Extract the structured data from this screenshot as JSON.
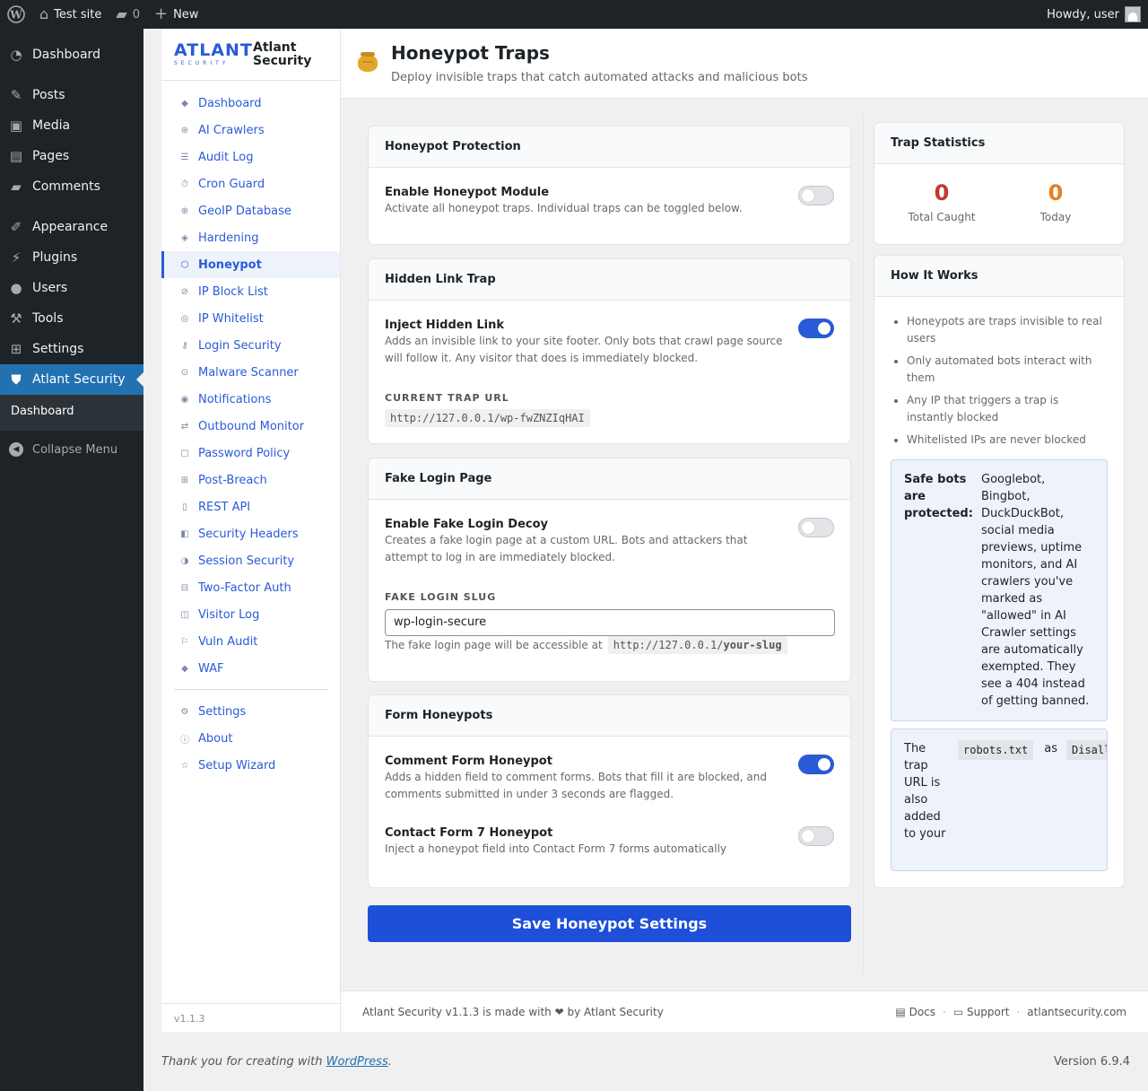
{
  "admin_bar": {
    "site_name": "Test site",
    "comments_count": "0",
    "new_label": "New",
    "greeting": "Howdy, user"
  },
  "admin_menu": {
    "items": [
      {
        "label": "Dashboard",
        "icon": "dashboard-icon"
      },
      {
        "label": "Posts",
        "icon": "pin-icon"
      },
      {
        "label": "Media",
        "icon": "media-icon"
      },
      {
        "label": "Pages",
        "icon": "pages-icon"
      },
      {
        "label": "Comments",
        "icon": "comments-icon"
      },
      {
        "label": "Appearance",
        "icon": "brush-icon"
      },
      {
        "label": "Plugins",
        "icon": "plugin-icon"
      },
      {
        "label": "Users",
        "icon": "user-icon"
      },
      {
        "label": "Tools",
        "icon": "wrench-icon"
      },
      {
        "label": "Settings",
        "icon": "sliders-icon"
      },
      {
        "label": "Atlant Security",
        "icon": "shield-icon"
      }
    ],
    "submenu_item": "Dashboard",
    "collapse_label": "Collapse Menu"
  },
  "brand": {
    "logo_text": "ATLANT",
    "logo_subtext": "SECURITY",
    "name_line1": "Atlant",
    "name_line2": "Security"
  },
  "plugin_nav": {
    "items": [
      {
        "label": "Dashboard",
        "glyph": "◆"
      },
      {
        "label": "AI Crawlers",
        "glyph": "⊛"
      },
      {
        "label": "Audit Log",
        "glyph": "☰"
      },
      {
        "label": "Cron Guard",
        "glyph": "⏱"
      },
      {
        "label": "GeoIP Database",
        "glyph": "⊕"
      },
      {
        "label": "Hardening",
        "glyph": "◈"
      },
      {
        "label": "Honeypot",
        "glyph": "⬡"
      },
      {
        "label": "IP Block List",
        "glyph": "⊘"
      },
      {
        "label": "IP Whitelist",
        "glyph": "◎"
      },
      {
        "label": "Login Security",
        "glyph": "⚷"
      },
      {
        "label": "Malware Scanner",
        "glyph": "⊙"
      },
      {
        "label": "Notifications",
        "glyph": "◉"
      },
      {
        "label": "Outbound Monitor",
        "glyph": "⇄"
      },
      {
        "label": "Password Policy",
        "glyph": "▢"
      },
      {
        "label": "Post-Breach",
        "glyph": "⊞"
      },
      {
        "label": "REST API",
        "glyph": "▯"
      },
      {
        "label": "Security Headers",
        "glyph": "◧"
      },
      {
        "label": "Session Security",
        "glyph": "◑"
      },
      {
        "label": "Two-Factor Auth",
        "glyph": "⊟"
      },
      {
        "label": "Visitor Log",
        "glyph": "◫"
      },
      {
        "label": "Vuln Audit",
        "glyph": "⚐"
      },
      {
        "label": "WAF",
        "glyph": "◆"
      }
    ],
    "secondary": [
      {
        "label": "Settings",
        "glyph": "⚙"
      },
      {
        "label": "About",
        "glyph": "ⓘ"
      },
      {
        "label": "Setup Wizard",
        "glyph": "☆"
      }
    ],
    "active": "Honeypot",
    "version": "v1.1.3"
  },
  "header": {
    "title": "Honeypot Traps",
    "subtitle": "Deploy invisible traps that catch automated attacks and malicious bots"
  },
  "honeypot_protection": {
    "heading": "Honeypot Protection",
    "enable_title": "Enable Honeypot Module",
    "enable_desc": "Activate all honeypot traps. Individual traps can be toggled below.",
    "enabled": false
  },
  "hidden_link_trap": {
    "heading": "Hidden Link Trap",
    "inject_title": "Inject Hidden Link",
    "inject_desc": "Adds an invisible link to your site footer. Only bots that crawl page source will follow it. Any visitor that does is immediately blocked.",
    "enabled": true,
    "trap_url_label": "Current Trap URL",
    "trap_url": "http://127.0.0.1/wp-fwZNZIqHAI"
  },
  "fake_login": {
    "heading": "Fake Login Page",
    "enable_title": "Enable Fake Login Decoy",
    "enable_desc": "Creates a fake login page at a custom URL. Bots and attackers that attempt to log in are immediately blocked.",
    "enabled": false,
    "slug_label": "Fake Login Slug",
    "slug_value": "wp-login-secure",
    "help_text": "The fake login page will be accessible at",
    "help_url_base": "http://127.0.0.1/",
    "help_url_slug": "your-slug"
  },
  "form_honeypots": {
    "heading": "Form Honeypots",
    "comment_title": "Comment Form Honeypot",
    "comment_desc": "Adds a hidden field to comment forms. Bots that fill it are blocked, and comments submitted in under 3 seconds are flagged.",
    "comment_enabled": true,
    "cf7_title": "Contact Form 7 Honeypot",
    "cf7_desc": "Inject a honeypot field into Contact Form 7 forms automatically",
    "cf7_enabled": false
  },
  "save_button": "Save Honeypot Settings",
  "trap_statistics": {
    "heading": "Trap Statistics",
    "total_caught": "0",
    "total_caught_label": "Total Caught",
    "today": "0",
    "today_label": "Today",
    "total_color": "#c0392b",
    "today_color": "#e67e22"
  },
  "how_it_works": {
    "heading": "How It Works",
    "items": [
      "Honeypots are traps invisible to real users",
      "Only automated bots interact with them",
      "Any IP that triggers a trap is instantly blocked",
      "Whitelisted IPs are never blocked"
    ],
    "safe_bots_label": "Safe bots are protected:",
    "safe_bots_text": "Googlebot, Bingbot, DuckDuckBot, social media previews, uptime monitors, and AI crawlers you've marked as \"allowed\" in AI Crawler settings are automatically exempted. They see a 404 instead of getting banned.",
    "robots_text": "The trap URL is also added to your",
    "robots_file": "robots.txt",
    "robots_as": "as",
    "robots_disallow": "Disallow"
  },
  "plugin_footer": {
    "made_with_prefix": "Atlant Security v1.1.3 is made with",
    "made_with_suffix": "by Atlant Security",
    "docs": "Docs",
    "support": "Support",
    "site": "atlantsecurity.com"
  },
  "wp_footer": {
    "thanks_prefix": "Thank you for creating with",
    "thanks_link": "WordPress",
    "thanks_suffix": ".",
    "version": "Version 6.9.4"
  },
  "colors": {
    "accent": "#2a5bd7",
    "save_button": "#1d4fd8",
    "admin_bar": "#1d2327",
    "wp_current": "#2271b1"
  }
}
